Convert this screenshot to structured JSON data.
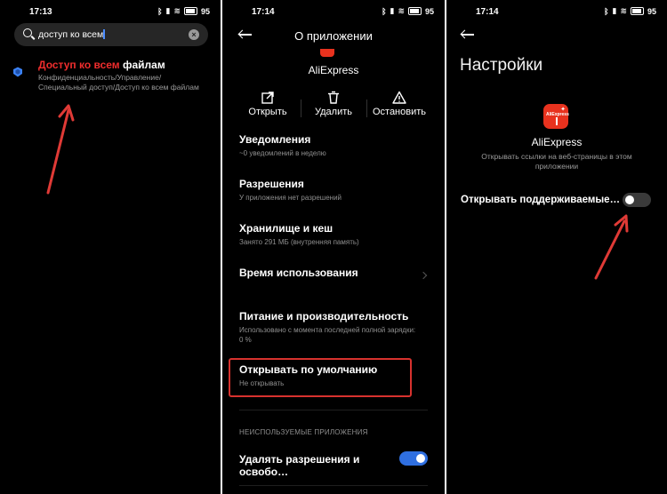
{
  "colors": {
    "background": "#000000",
    "highlight_red": "#ef2d2d",
    "toggle_on": "#2f6fe0",
    "app_brand": "#e8321e"
  },
  "panel1": {
    "status": {
      "time": "17:13",
      "battery": "95"
    },
    "search": {
      "query": "доступ ко всем"
    },
    "result": {
      "title_highlight": "Доступ ко всем",
      "title_rest": " файлам",
      "path_line1": "Конфиденциальность/Управление/",
      "path_line2": "Специальный доступ/Доступ ко всем файлам"
    }
  },
  "panel2": {
    "status": {
      "time": "17:14",
      "battery": "95"
    },
    "title": "О приложении",
    "app_name": "AliExpress",
    "actions": {
      "open": "Открыть",
      "delete": "Удалить",
      "stop": "Остановить"
    },
    "items": [
      {
        "title": "Уведомления",
        "subtitle": "~0 уведомлений в неделю"
      },
      {
        "title": "Разрешения",
        "subtitle": "У приложения нет разрешений"
      },
      {
        "title": "Хранилище и кеш",
        "subtitle": "Занято 291 МБ (внутренняя память)"
      },
      {
        "title": "Время использования",
        "subtitle": ""
      },
      {
        "title": "Питание и производительность",
        "subtitle": "Использовано с момента последней полной зарядки: 0 %"
      },
      {
        "title": "Открывать по умолчанию",
        "subtitle": "Не открывать"
      }
    ],
    "section_label": "НЕИСПОЛЬЗУЕМЫЕ ПРИЛОЖЕНИЯ",
    "unused_toggle": {
      "label": "Удалять разрешения и освобо…",
      "on": true
    }
  },
  "panel3": {
    "status": {
      "time": "17:14",
      "battery": "95"
    },
    "title": "Настройки",
    "app_name": "AliExpress",
    "app_icon_text": "AliExpress",
    "description": "Открывать ссылки на веб-страницы в этом приложении",
    "setting": {
      "label": "Открывать поддерживаемые…",
      "on": false
    }
  }
}
